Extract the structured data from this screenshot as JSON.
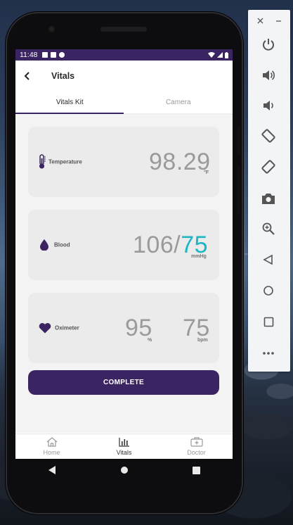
{
  "status_bar": {
    "time": "11:48"
  },
  "app_bar": {
    "title": "Vitals"
  },
  "tabs": [
    {
      "label": "Vitals Kit",
      "active": true
    },
    {
      "label": "Camera",
      "active": false
    }
  ],
  "cards": {
    "temperature": {
      "label": "Temperature",
      "value": "98.29",
      "unit": "°F"
    },
    "blood": {
      "label": "Blood",
      "systolic": "106",
      "separator": "/",
      "diastolic": "75",
      "unit": "mmHg"
    },
    "oximeter": {
      "label": "Oximeter",
      "spo2": "95",
      "spo2_unit": "%",
      "pulse": "75",
      "pulse_unit": "bpm"
    }
  },
  "complete_button": {
    "label": "COMPLETE"
  },
  "bottom_nav": [
    {
      "label": "Home",
      "icon": "home-icon",
      "active": false
    },
    {
      "label": "Vitals",
      "icon": "bar-chart-icon",
      "active": true
    },
    {
      "label": "Doctor",
      "icon": "medical-kit-icon",
      "active": false
    }
  ],
  "colors": {
    "primary": "#3b2462",
    "accent": "#1bb7c4",
    "card_bg": "#ebebeb"
  },
  "emulator_panel": {
    "controls": [
      "power-icon",
      "volume-up-icon",
      "volume-down-icon",
      "rotate-left-icon",
      "rotate-right-icon",
      "screenshot-icon",
      "zoom-icon",
      "back-icon",
      "home-icon",
      "overview-icon",
      "more-icon"
    ]
  }
}
